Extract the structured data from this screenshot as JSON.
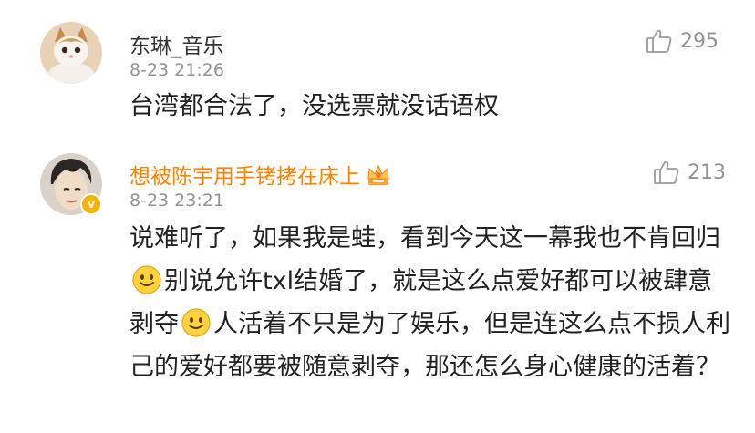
{
  "comments": [
    {
      "username": "东琳_音乐",
      "time": "8-23 21:26",
      "likes": "295",
      "text": "台湾都合法了，没选票就没话语权"
    },
    {
      "username": "想被陈宇用手铐拷在床上",
      "time": "8-23 23:21",
      "likes": "213",
      "verified_badge": "v",
      "text_parts": [
        "说难听了，如果我是蛙，看到今天这一幕我也不肯回归",
        "别说允许txl结婚了，就是这么点爱好都可以被肆意剥夺",
        "人活着不只是为了娱乐，但是连这么点不损人利己的爱好都要被随意剥夺，那还怎么身心健康的活着？"
      ]
    }
  ],
  "icons": {
    "like": "thumbs-up-icon",
    "emoji": "smile-emoji-icon",
    "crown": "vip-crown-icon"
  },
  "colors": {
    "vip_username": "#ff8200",
    "meta_gray": "#939393",
    "verified": "#f5b400"
  }
}
